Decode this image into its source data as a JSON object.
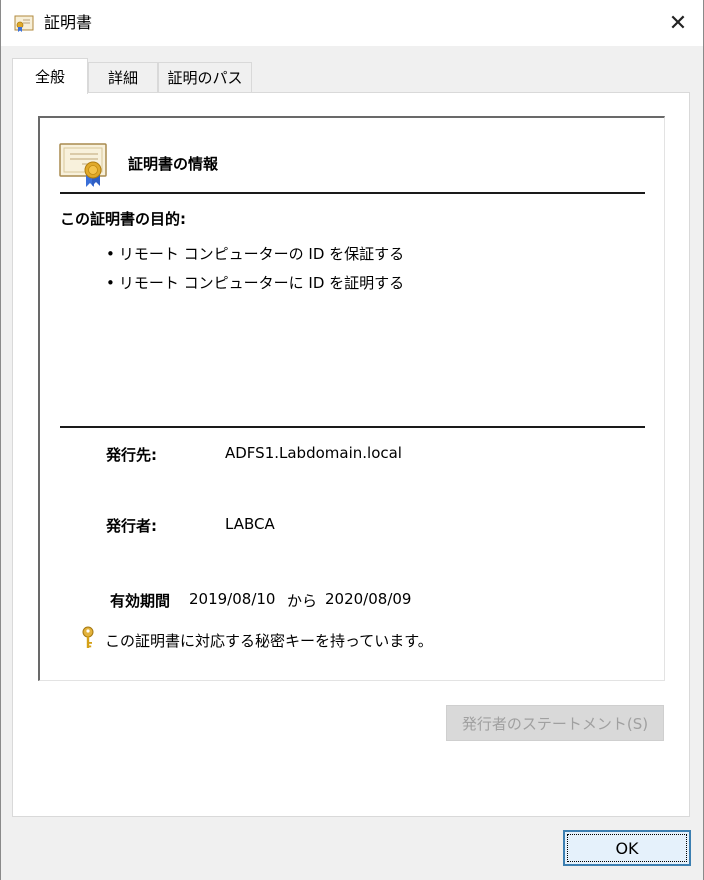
{
  "window": {
    "title": "証明書",
    "close_glyph": "✕"
  },
  "tabs": [
    {
      "label": "全般",
      "active": true
    },
    {
      "label": "詳細",
      "active": false
    },
    {
      "label": "証明のパス",
      "active": false
    }
  ],
  "general": {
    "heading": "証明書の情報",
    "purpose_title": "この証明書の目的:",
    "purposes": [
      "リモート コンピューターの ID を保証する",
      "リモート コンピューターに ID を証明する"
    ],
    "issued_to_label": "発行先:",
    "issued_to_value": "ADFS1.Labdomain.local",
    "issued_by_label": "発行者:",
    "issued_by_value": "LABCA",
    "validity_label": "有効期間",
    "valid_from": "2019/08/10",
    "valid_from_sep": "から",
    "valid_to": "2020/08/09",
    "private_key_note": "この証明書に対応する秘密キーを持っています。",
    "statement_button": "発行者のステートメント(S)"
  },
  "footer": {
    "ok_button": "OK"
  },
  "icons": {
    "title": "certificate-icon",
    "cert": "certificate-icon",
    "key": "key-icon"
  },
  "colors": {
    "key": "#d4a017",
    "ribbon": "#3a6fd8",
    "seal": "#e0a92a",
    "focus_border": "#3c7fb1"
  }
}
